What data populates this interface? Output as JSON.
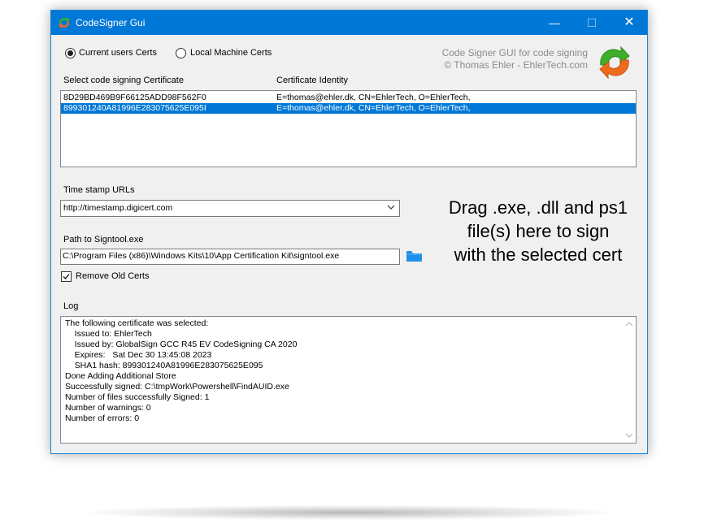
{
  "window": {
    "title": "CodeSigner Gui",
    "buttons": {
      "minimize": "—",
      "maximize": "☐",
      "close": "✕"
    }
  },
  "cert_store": {
    "options": [
      "Current users Certs",
      "Local Machine Certs"
    ],
    "selected": "Current users Certs"
  },
  "credits": {
    "line1": "Code Signer GUI for code signing",
    "line2": "© Thomas Ehler - EhlerTech.com"
  },
  "cert_list": {
    "header_cert": "Select code signing Certificate",
    "header_identity": "Certificate Identity",
    "rows": [
      {
        "thumbprint": "8D29BD469B9F66125ADD98F562F0",
        "identity": "E=thomas@ehler.dk, CN=EhlerTech, O=EhlerTech,",
        "selected": false
      },
      {
        "thumbprint": "899301240A81996E283075625E095I",
        "identity": "E=thomas@ehler.dk, CN=EhlerTech, O=EhlerTech,",
        "selected": true
      }
    ]
  },
  "timestamp": {
    "label": "Time stamp URLs",
    "value": "http://timestamp.digicert.com"
  },
  "signtool": {
    "label": "Path to Signtool.exe",
    "value": "C:\\Program Files (x86)\\Windows Kits\\10\\App Certification Kit\\signtool.exe"
  },
  "remove_old": {
    "label": "Remove Old Certs",
    "checked": true
  },
  "drop_hint": {
    "line1": "Drag .exe, .dll and ps1",
    "line2": "file(s) here to sign",
    "line3": "with the selected cert"
  },
  "log": {
    "label": "Log",
    "lines": [
      "The following certificate was selected:",
      "    Issued to: EhlerTech",
      "    Issued by: GlobalSign GCC R45 EV CodeSigning CA 2020",
      "    Expires:   Sat Dec 30 13:45:08 2023",
      "    SHA1 hash: 899301240A81996E283075625E095",
      "Done Adding Additional Store",
      "Successfully signed: C:\\tmpWork\\Powershell\\FindAUID.exe",
      "Number of files successfully Signed: 1",
      "Number of warnings: 0",
      "Number of errors: 0"
    ]
  },
  "icons": {
    "app": "codesigner-arrows-icon",
    "folder": "folder-icon",
    "dropdown": "chevron-down-icon"
  },
  "colors": {
    "titlebar": "#0078d7",
    "selection": "#0078d7",
    "folder": "#1e90e8",
    "logo_green": "#3fae2a",
    "logo_orange": "#f06a1d"
  }
}
